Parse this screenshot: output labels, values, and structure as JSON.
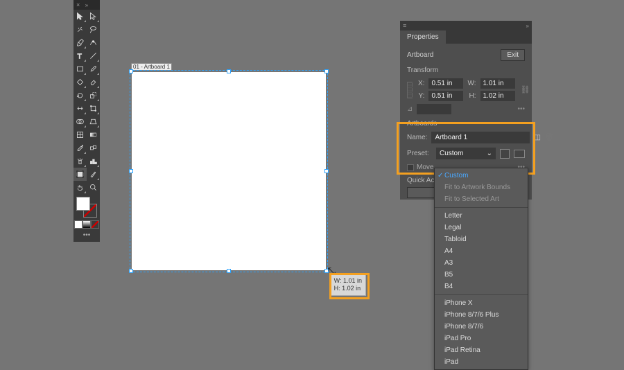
{
  "panel": {
    "tab_label": "Properties",
    "selection_label": "Artboard",
    "exit_label": "Exit",
    "transform_title": "Transform",
    "x_label": "X:",
    "y_label": "Y:",
    "w_label": "W:",
    "h_label": "H:",
    "x_value": "0.51 in",
    "y_value": "0.51 in",
    "w_value": "1.01 in",
    "h_value": "1.02 in",
    "artboards_title": "Artboards",
    "name_label": "Name:",
    "name_value": "Artboard 1",
    "preset_label": "Preset:",
    "preset_selected": "Custom",
    "move_label": "Move",
    "quick_actions_title": "Quick Actions"
  },
  "dropdown": {
    "items": [
      {
        "label": "Custom",
        "selected": true
      },
      {
        "label": "Fit to Artwork Bounds",
        "dim": true
      },
      {
        "label": "Fit to Selected Art",
        "dim": true
      },
      {
        "sep": true
      },
      {
        "label": "Letter"
      },
      {
        "label": "Legal"
      },
      {
        "label": "Tabloid"
      },
      {
        "label": "A4"
      },
      {
        "label": "A3"
      },
      {
        "label": "B5"
      },
      {
        "label": "B4"
      },
      {
        "sep": true
      },
      {
        "label": "iPhone X"
      },
      {
        "label": "iPhone 8/7/6 Plus"
      },
      {
        "label": "iPhone 8/7/6"
      },
      {
        "label": "iPad Pro"
      },
      {
        "label": "iPad Retina"
      },
      {
        "label": "iPad"
      }
    ]
  },
  "artboard": {
    "label": "01 - Artboard 1",
    "float_w": "W: 1.01 in",
    "float_h": "H: 1.02 in"
  }
}
